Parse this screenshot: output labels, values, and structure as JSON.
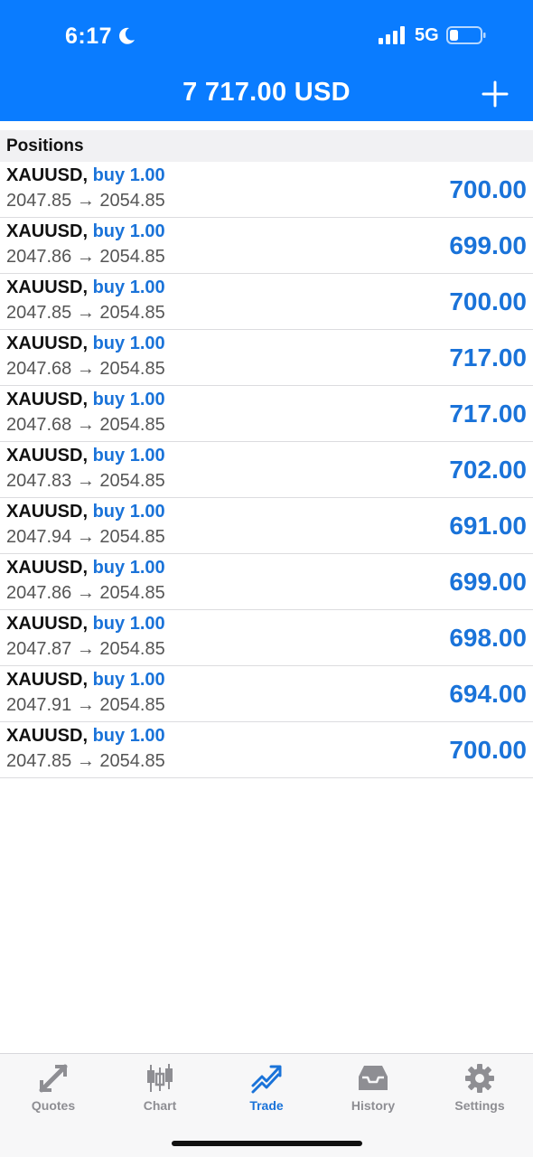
{
  "status_bar": {
    "time": "6:17",
    "network": "5G",
    "icons": [
      "moon-icon",
      "signal-icon",
      "battery-icon"
    ]
  },
  "header": {
    "balance": "7 717.00 USD",
    "add_icon": "plus-icon"
  },
  "section": {
    "title": "Positions"
  },
  "positions": [
    {
      "symbol": "XAUUSD",
      "sep": ",",
      "side": "buy 1.00",
      "prices": "2047.85 → 2054.85",
      "profit": "700.00"
    },
    {
      "symbol": "XAUUSD",
      "sep": ",",
      "side": "buy 1.00",
      "prices": "2047.86 → 2054.85",
      "profit": "699.00"
    },
    {
      "symbol": "XAUUSD",
      "sep": ",",
      "side": "buy 1.00",
      "prices": "2047.85 → 2054.85",
      "profit": "700.00"
    },
    {
      "symbol": "XAUUSD",
      "sep": ",",
      "side": "buy 1.00",
      "prices": "2047.68 → 2054.85",
      "profit": "717.00"
    },
    {
      "symbol": "XAUUSD",
      "sep": ",",
      "side": "buy 1.00",
      "prices": "2047.68 → 2054.85",
      "profit": "717.00"
    },
    {
      "symbol": "XAUUSD",
      "sep": ",",
      "side": "buy 1.00",
      "prices": "2047.83 → 2054.85",
      "profit": "702.00"
    },
    {
      "symbol": "XAUUSD",
      "sep": ",",
      "side": "buy 1.00",
      "prices": "2047.94 → 2054.85",
      "profit": "691.00"
    },
    {
      "symbol": "XAUUSD",
      "sep": ",",
      "side": "buy 1.00",
      "prices": "2047.86 → 2054.85",
      "profit": "699.00"
    },
    {
      "symbol": "XAUUSD",
      "sep": ",",
      "side": "buy 1.00",
      "prices": "2047.87 → 2054.85",
      "profit": "698.00"
    },
    {
      "symbol": "XAUUSD",
      "sep": ",",
      "side": "buy 1.00",
      "prices": "2047.91 → 2054.85",
      "profit": "694.00"
    },
    {
      "symbol": "XAUUSD",
      "sep": ",",
      "side": "buy 1.00",
      "prices": "2047.85 → 2054.85",
      "profit": "700.00"
    }
  ],
  "tabs": [
    {
      "label": "Quotes",
      "icon": "quotes-icon",
      "active": false
    },
    {
      "label": "Chart",
      "icon": "candlestick-icon",
      "active": false
    },
    {
      "label": "Trade",
      "icon": "trade-icon",
      "active": true
    },
    {
      "label": "History",
      "icon": "inbox-icon",
      "active": false
    },
    {
      "label": "Settings",
      "icon": "gear-icon",
      "active": false
    }
  ],
  "colors": {
    "header_bg": "#0a7cff",
    "accent": "#1a73d9",
    "inactive_tab": "#8e8e93"
  }
}
